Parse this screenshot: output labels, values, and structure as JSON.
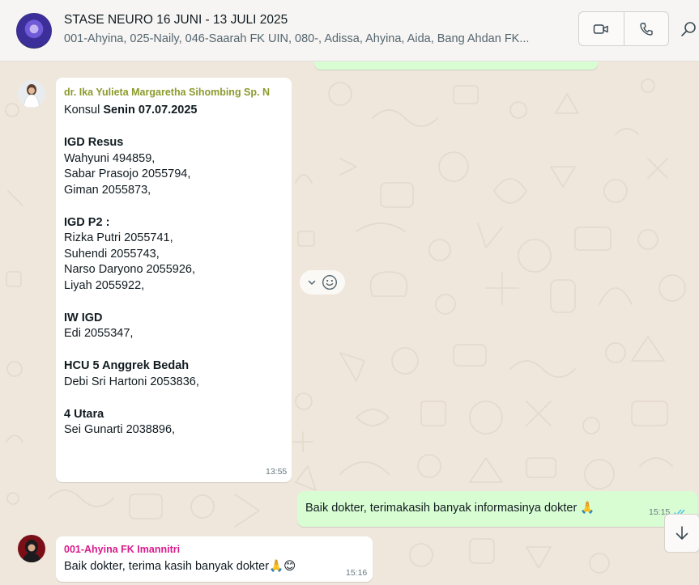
{
  "header": {
    "title": "STASE NEURO 16 JUNI - 13 JULI 2025",
    "participants": "001-Ahyina, 025-Naily, 046-Saarah FK UIN, 080-, Adissa, Ahyina, Aida, Bang Ahdan FK...",
    "icons": [
      "video-call-icon",
      "voice-call-icon",
      "search-icon"
    ]
  },
  "messages": {
    "m1": {
      "sender": "dr. Ika Yulieta Margaretha Sihombing Sp. N",
      "sender_color": "#8c9b2c",
      "konsul_prefix": "Konsul ",
      "konsul_day": "Senin 07.07.2025",
      "s1_title": "IGD Resus",
      "s1_l1": "Wahyuni 494859,",
      "s1_l2": "Sabar Prasojo 2055794,",
      "s1_l3": "Giman 2055873,",
      "s2_title": "IGD P2 :",
      "s2_l1": "Rizka Putri 2055741,",
      "s2_l2": "Suhendi 2055743,",
      "s2_l3": "Narso Daryono 2055926,",
      "s2_l4": "Liyah 2055922,",
      "s3_title": "IW IGD",
      "s3_l1": "Edi 2055347,",
      "s4_title": "HCU 5 Anggrek Bedah",
      "s4_l1": "Debi Sri Hartoni 2053836,",
      "s5_title": "4 Utara",
      "s5_l1": "Sei Gunarti 2038896,",
      "time": "13:55"
    },
    "m2": {
      "text": "Baik dokter, terimakasih banyak informasinya dokter 🙏",
      "time": "15:15",
      "status": "read"
    },
    "m3": {
      "sender": "001-Ahyina FK Imannitri",
      "sender_color": "#d81b8c",
      "text": "Baik dokter, terima kasih banyak dokter🙏😊",
      "time": "15:16"
    }
  },
  "colors": {
    "wallpaper": "#efe6dc",
    "bubble_in": "#ffffff",
    "bubble_out": "#d9fdd3",
    "read_ticks": "#53bdeb"
  }
}
